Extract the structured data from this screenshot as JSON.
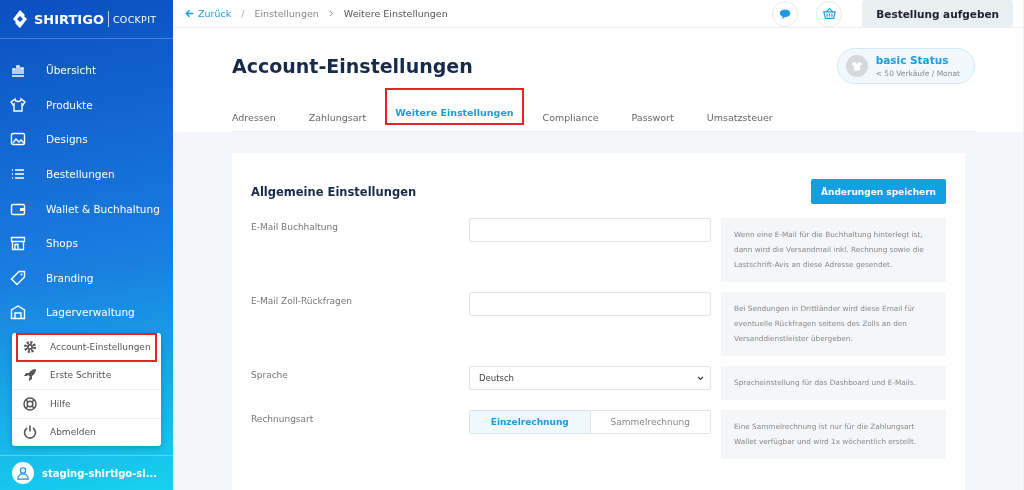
{
  "brand": {
    "name": "SHIRTIGO",
    "product": "COCKPIT"
  },
  "sidebar": {
    "items": [
      {
        "label": "Übersicht"
      },
      {
        "label": "Produkte"
      },
      {
        "label": "Designs"
      },
      {
        "label": "Bestellungen"
      },
      {
        "label": "Wallet & Buchhaltung"
      },
      {
        "label": "Shops"
      },
      {
        "label": "Branding"
      },
      {
        "label": "Lagerverwaltung"
      }
    ],
    "account_menu": [
      {
        "label": "Account-Einstellungen",
        "highlighted": true
      },
      {
        "label": "Erste Schritte",
        "highlighted": false
      },
      {
        "label": "Hilfe",
        "highlighted": false
      },
      {
        "label": "Abmelden",
        "highlighted": false
      }
    ],
    "user": {
      "name": "staging-shirtigo-si..."
    }
  },
  "breadcrumb": {
    "back": "Zurück",
    "separator": "/",
    "items": [
      "Einstellungen",
      "Weitere Einstellungen"
    ]
  },
  "topbar": {
    "order_button": "Bestellung aufgeben"
  },
  "page": {
    "title": "Account-Einstellungen",
    "status": {
      "title": "basic Status",
      "subtitle": "< 50 Verkäufe / Monat"
    }
  },
  "tabs": [
    {
      "label": "Adressen",
      "selected": false,
      "highlighted": false
    },
    {
      "label": "Zahlungsart",
      "selected": false,
      "highlighted": false
    },
    {
      "label": "Weitere Einstellungen",
      "selected": true,
      "highlighted": true
    },
    {
      "label": "Compliance",
      "selected": false,
      "highlighted": false
    },
    {
      "label": "Passwort",
      "selected": false,
      "highlighted": false
    },
    {
      "label": "Umsatzsteuer",
      "selected": false,
      "highlighted": false
    }
  ],
  "section": {
    "title": "Allgemeine Einstellungen",
    "save_button": "Änderungen speichern",
    "fields": [
      {
        "kind": "text",
        "label": "E-Mail Buchhaltung",
        "hint": "Wenn eine E-Mail für die Buchhaltung hinterlegt ist, dann wird die Versandmail inkl. Rechnung sowie die Lastschrift-Avis an diese Adresse gesendet."
      },
      {
        "kind": "text",
        "label": "E-Mail Zoll-Rückfragen",
        "hint": "Bei Sendungen in Drittländer wird diese Email für eventuelle Rückfragen seitens des Zolls an den Versanddienstleister übergeben."
      },
      {
        "kind": "select",
        "label": "Sprache",
        "value": "Deutsch",
        "hint": "Spracheinstellung für das Dashboard und E-Mails."
      },
      {
        "kind": "toggle",
        "label": "Rechnungsart",
        "options": [
          {
            "label": "Einzelrechnung",
            "selected": true
          },
          {
            "label": "Sammelrechnung",
            "selected": false
          }
        ],
        "hint": "Eine Sammelrechnung ist nur für die Zahlungsart Wallet verfügbar und wird 1x wöchentlich erstellt."
      }
    ]
  }
}
